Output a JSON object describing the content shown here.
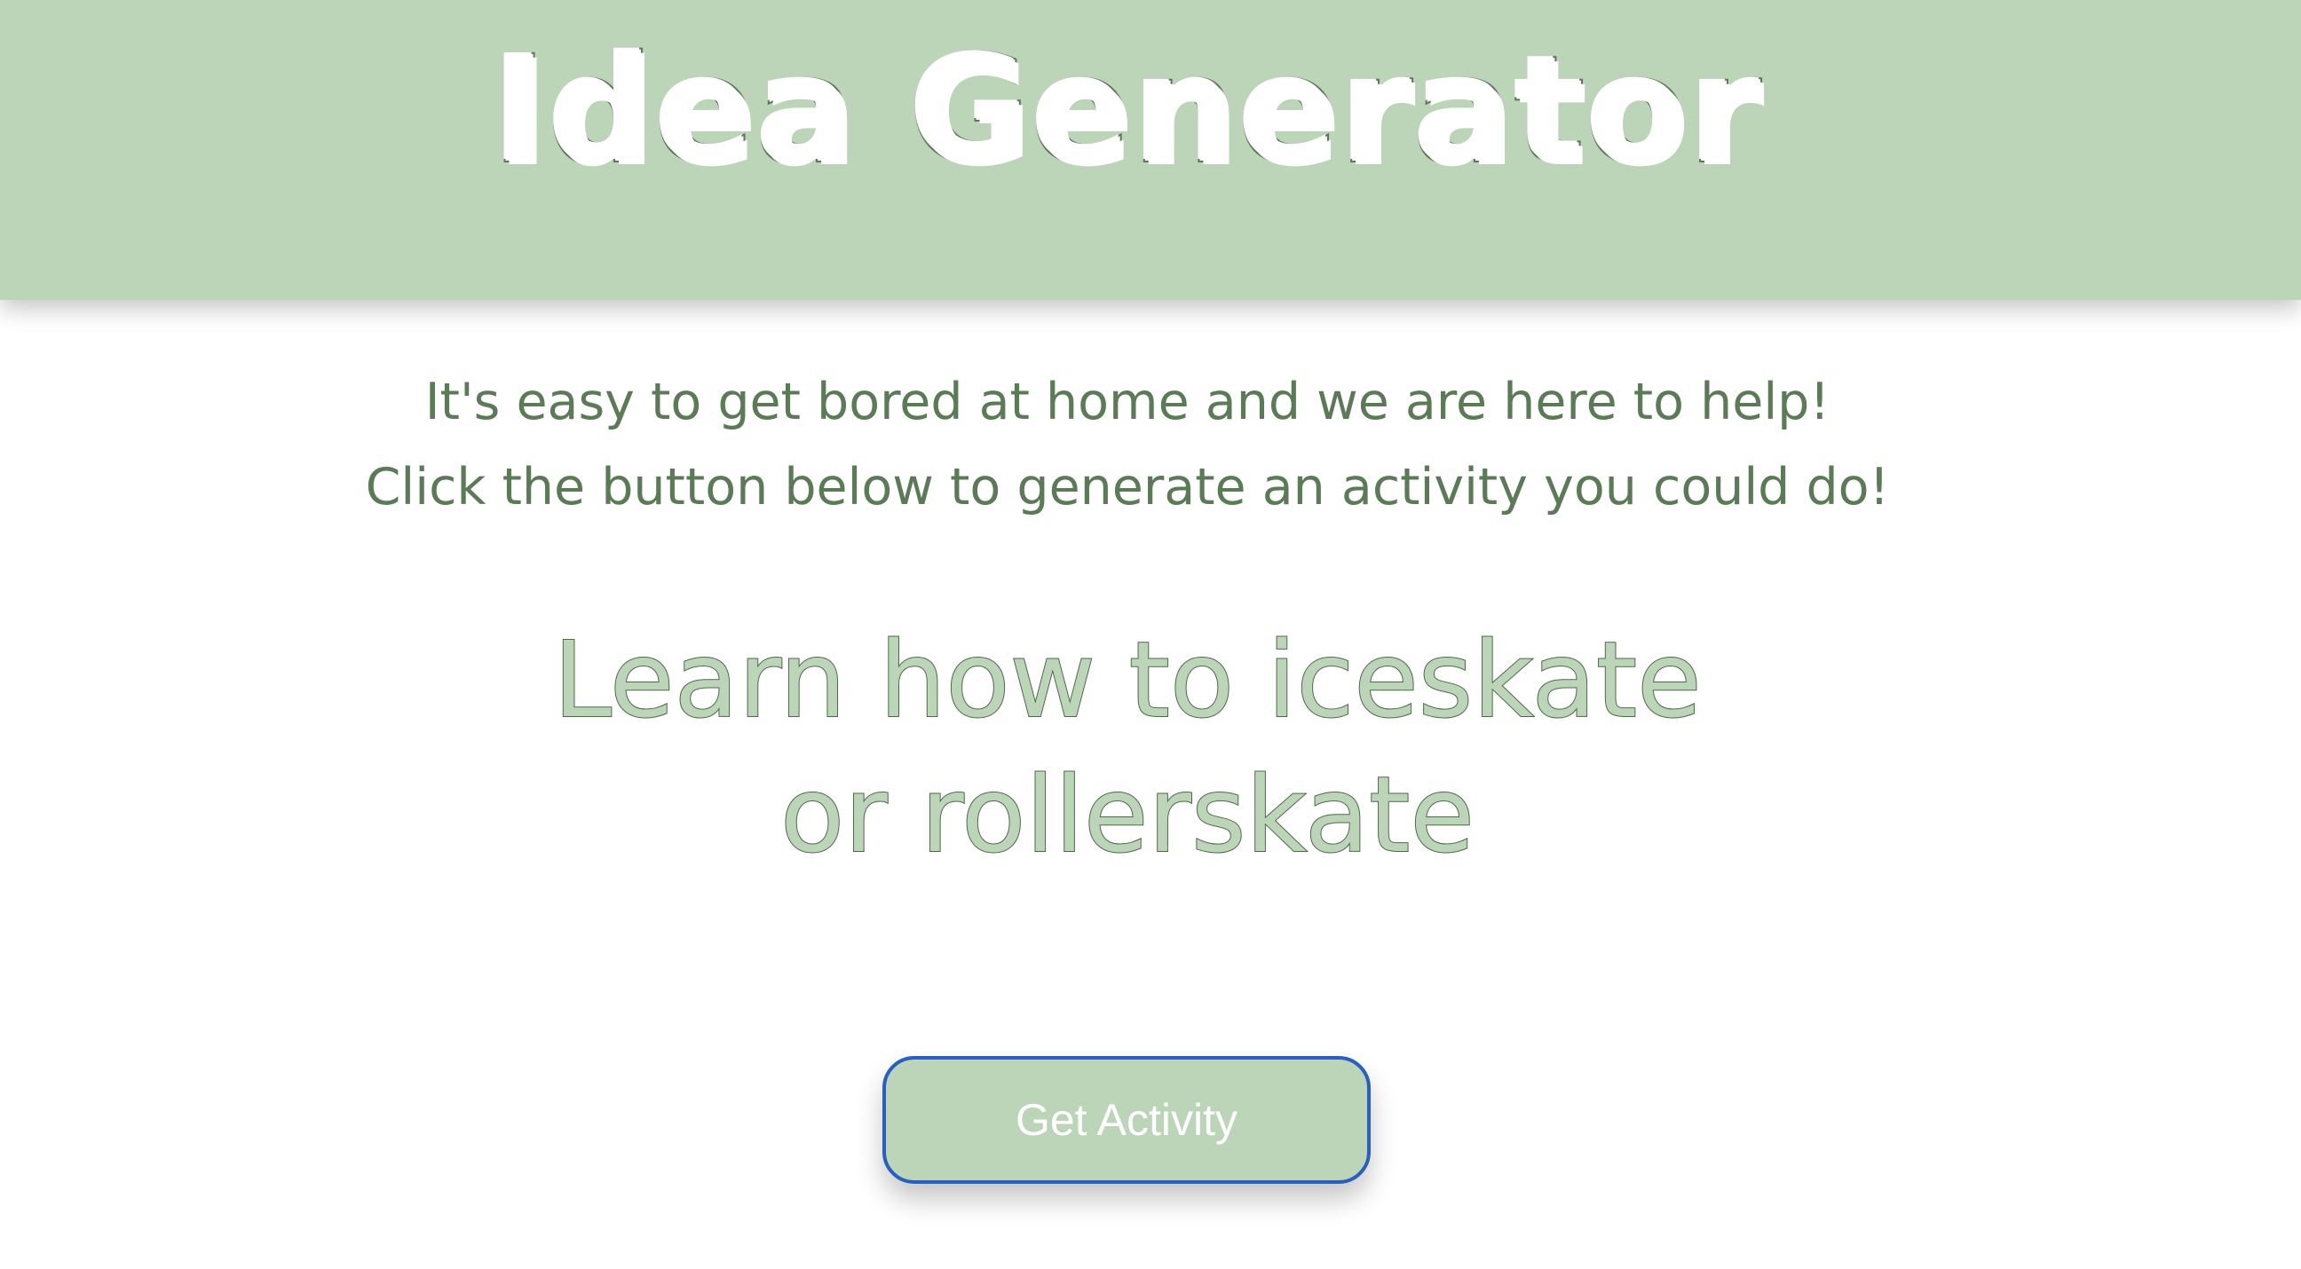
{
  "header": {
    "title": "Idea Generator",
    "background_color": "#bcd5b8"
  },
  "intro": {
    "line1": "It's easy to get bored at home and we are here to help!",
    "line2": "Click the button below to generate an activity you could do!",
    "text_color": "#5b7a56"
  },
  "activity": {
    "line1": "Learn how to iceskate",
    "line2": "or rollerskate"
  },
  "button": {
    "label": "Get Activity",
    "border_color": "#2a5fbf"
  }
}
